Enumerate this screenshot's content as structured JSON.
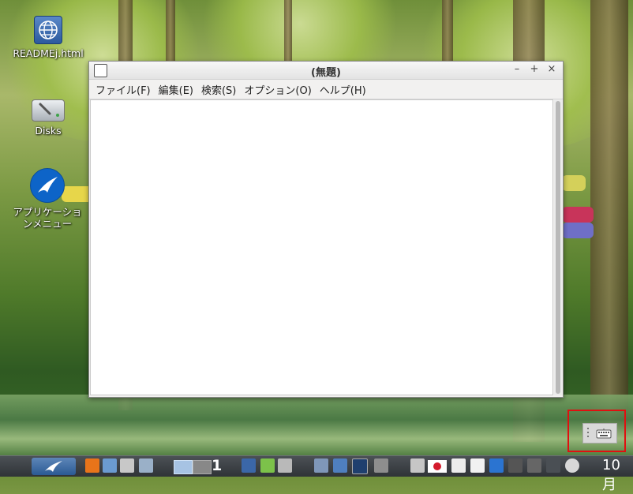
{
  "desktop": {
    "icons": [
      {
        "label": "READMEj.html"
      },
      {
        "label": "Disks"
      },
      {
        "label": "アプリケーションメニュー"
      }
    ]
  },
  "window": {
    "title": "(無題)",
    "controls": {
      "minimize": "–",
      "maximize": "+",
      "close": "×"
    },
    "menu": [
      "ファイル(F)",
      "編集(E)",
      "検索(S)",
      "オプション(O)",
      "ヘルプ(H)"
    ]
  },
  "taskbar": {
    "workspace_number": "1",
    "clock_text": "10月"
  },
  "colors": {
    "highlight_border": "#e01010",
    "flag_red": "#d41b2c"
  }
}
